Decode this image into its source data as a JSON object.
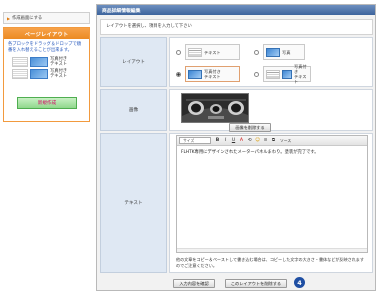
{
  "sidebar": {
    "link_label": "作成画面にする",
    "panel_title": "ページレイアウト",
    "panel_desc": "各ブロックをドラッグ＆ドロップで順番を入れ替えることが出来ます。",
    "layouts": [
      {
        "label": "写真付き\nテキスト"
      },
      {
        "label": "写真付き\nテキスト"
      }
    ],
    "new_button": "新規作成"
  },
  "card": {
    "title": "商品詳細情報編集",
    "instruction": "レイアウトを選択し、項目を入力して下さい",
    "layout_label": "レイアウト",
    "layout_options": [
      {
        "label": "テキスト"
      },
      {
        "label": "写真"
      },
      {
        "label": "写真付き\nテキスト"
      },
      {
        "label": "写真付き\nテキスト"
      }
    ],
    "image_label": "画像",
    "image_delete_button": "画像を削除する",
    "text_label": "テキスト",
    "editor": {
      "font_size_select": "サイズ",
      "tools": [
        "B",
        "I",
        "U",
        "A",
        "⟲",
        "☺",
        "≡",
        "⧉"
      ],
      "source_label": "ソース",
      "content": "FLHTK専用にデザインされたメーターパネルまわり。塗装が完了です。"
    },
    "hint": "他の文章をコピー＆ペーストして書き込む場合は、コピーした文字の大きさ・書体などが反映されますのでご注意ください。",
    "confirm_button": "入力内容を確認",
    "delete_layout_button": "このレイアウトを削除する",
    "step_badge": "4"
  },
  "colors": {
    "panel_orange": "#ec8a22",
    "header_blue": "#3d649c",
    "badge_blue": "#1f4fa3",
    "new_button_green": "#8fd88c",
    "new_button_text": "#d40060"
  }
}
